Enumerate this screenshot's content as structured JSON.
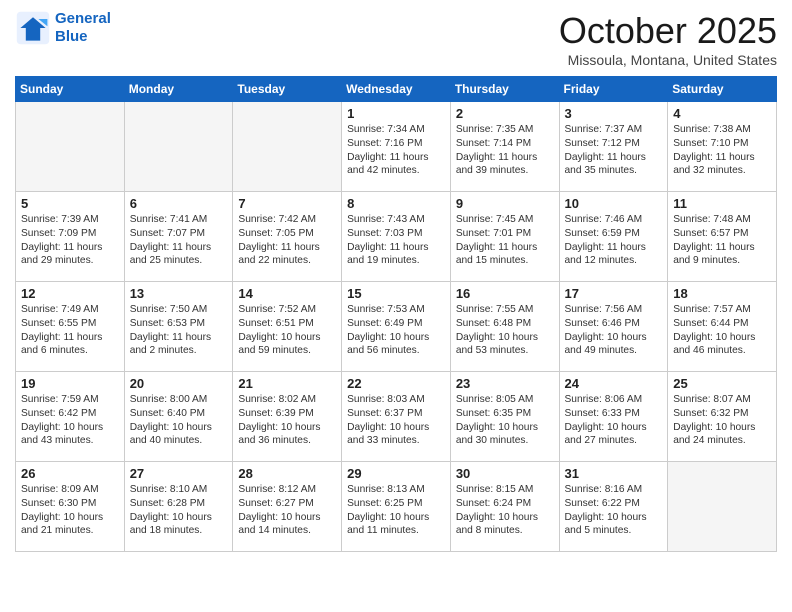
{
  "header": {
    "logo_line1": "General",
    "logo_line2": "Blue",
    "month": "October 2025",
    "location": "Missoula, Montana, United States"
  },
  "days_of_week": [
    "Sunday",
    "Monday",
    "Tuesday",
    "Wednesday",
    "Thursday",
    "Friday",
    "Saturday"
  ],
  "weeks": [
    [
      {
        "day": "",
        "info": "",
        "empty": true
      },
      {
        "day": "",
        "info": "",
        "empty": true
      },
      {
        "day": "",
        "info": "",
        "empty": true
      },
      {
        "day": "1",
        "info": "Sunrise: 7:34 AM\nSunset: 7:16 PM\nDaylight: 11 hours\nand 42 minutes.",
        "empty": false
      },
      {
        "day": "2",
        "info": "Sunrise: 7:35 AM\nSunset: 7:14 PM\nDaylight: 11 hours\nand 39 minutes.",
        "empty": false
      },
      {
        "day": "3",
        "info": "Sunrise: 7:37 AM\nSunset: 7:12 PM\nDaylight: 11 hours\nand 35 minutes.",
        "empty": false
      },
      {
        "day": "4",
        "info": "Sunrise: 7:38 AM\nSunset: 7:10 PM\nDaylight: 11 hours\nand 32 minutes.",
        "empty": false
      }
    ],
    [
      {
        "day": "5",
        "info": "Sunrise: 7:39 AM\nSunset: 7:09 PM\nDaylight: 11 hours\nand 29 minutes.",
        "empty": false
      },
      {
        "day": "6",
        "info": "Sunrise: 7:41 AM\nSunset: 7:07 PM\nDaylight: 11 hours\nand 25 minutes.",
        "empty": false
      },
      {
        "day": "7",
        "info": "Sunrise: 7:42 AM\nSunset: 7:05 PM\nDaylight: 11 hours\nand 22 minutes.",
        "empty": false
      },
      {
        "day": "8",
        "info": "Sunrise: 7:43 AM\nSunset: 7:03 PM\nDaylight: 11 hours\nand 19 minutes.",
        "empty": false
      },
      {
        "day": "9",
        "info": "Sunrise: 7:45 AM\nSunset: 7:01 PM\nDaylight: 11 hours\nand 15 minutes.",
        "empty": false
      },
      {
        "day": "10",
        "info": "Sunrise: 7:46 AM\nSunset: 6:59 PM\nDaylight: 11 hours\nand 12 minutes.",
        "empty": false
      },
      {
        "day": "11",
        "info": "Sunrise: 7:48 AM\nSunset: 6:57 PM\nDaylight: 11 hours\nand 9 minutes.",
        "empty": false
      }
    ],
    [
      {
        "day": "12",
        "info": "Sunrise: 7:49 AM\nSunset: 6:55 PM\nDaylight: 11 hours\nand 6 minutes.",
        "empty": false
      },
      {
        "day": "13",
        "info": "Sunrise: 7:50 AM\nSunset: 6:53 PM\nDaylight: 11 hours\nand 2 minutes.",
        "empty": false
      },
      {
        "day": "14",
        "info": "Sunrise: 7:52 AM\nSunset: 6:51 PM\nDaylight: 10 hours\nand 59 minutes.",
        "empty": false
      },
      {
        "day": "15",
        "info": "Sunrise: 7:53 AM\nSunset: 6:49 PM\nDaylight: 10 hours\nand 56 minutes.",
        "empty": false
      },
      {
        "day": "16",
        "info": "Sunrise: 7:55 AM\nSunset: 6:48 PM\nDaylight: 10 hours\nand 53 minutes.",
        "empty": false
      },
      {
        "day": "17",
        "info": "Sunrise: 7:56 AM\nSunset: 6:46 PM\nDaylight: 10 hours\nand 49 minutes.",
        "empty": false
      },
      {
        "day": "18",
        "info": "Sunrise: 7:57 AM\nSunset: 6:44 PM\nDaylight: 10 hours\nand 46 minutes.",
        "empty": false
      }
    ],
    [
      {
        "day": "19",
        "info": "Sunrise: 7:59 AM\nSunset: 6:42 PM\nDaylight: 10 hours\nand 43 minutes.",
        "empty": false
      },
      {
        "day": "20",
        "info": "Sunrise: 8:00 AM\nSunset: 6:40 PM\nDaylight: 10 hours\nand 40 minutes.",
        "empty": false
      },
      {
        "day": "21",
        "info": "Sunrise: 8:02 AM\nSunset: 6:39 PM\nDaylight: 10 hours\nand 36 minutes.",
        "empty": false
      },
      {
        "day": "22",
        "info": "Sunrise: 8:03 AM\nSunset: 6:37 PM\nDaylight: 10 hours\nand 33 minutes.",
        "empty": false
      },
      {
        "day": "23",
        "info": "Sunrise: 8:05 AM\nSunset: 6:35 PM\nDaylight: 10 hours\nand 30 minutes.",
        "empty": false
      },
      {
        "day": "24",
        "info": "Sunrise: 8:06 AM\nSunset: 6:33 PM\nDaylight: 10 hours\nand 27 minutes.",
        "empty": false
      },
      {
        "day": "25",
        "info": "Sunrise: 8:07 AM\nSunset: 6:32 PM\nDaylight: 10 hours\nand 24 minutes.",
        "empty": false
      }
    ],
    [
      {
        "day": "26",
        "info": "Sunrise: 8:09 AM\nSunset: 6:30 PM\nDaylight: 10 hours\nand 21 minutes.",
        "empty": false
      },
      {
        "day": "27",
        "info": "Sunrise: 8:10 AM\nSunset: 6:28 PM\nDaylight: 10 hours\nand 18 minutes.",
        "empty": false
      },
      {
        "day": "28",
        "info": "Sunrise: 8:12 AM\nSunset: 6:27 PM\nDaylight: 10 hours\nand 14 minutes.",
        "empty": false
      },
      {
        "day": "29",
        "info": "Sunrise: 8:13 AM\nSunset: 6:25 PM\nDaylight: 10 hours\nand 11 minutes.",
        "empty": false
      },
      {
        "day": "30",
        "info": "Sunrise: 8:15 AM\nSunset: 6:24 PM\nDaylight: 10 hours\nand 8 minutes.",
        "empty": false
      },
      {
        "day": "31",
        "info": "Sunrise: 8:16 AM\nSunset: 6:22 PM\nDaylight: 10 hours\nand 5 minutes.",
        "empty": false
      },
      {
        "day": "",
        "info": "",
        "empty": true
      }
    ]
  ]
}
